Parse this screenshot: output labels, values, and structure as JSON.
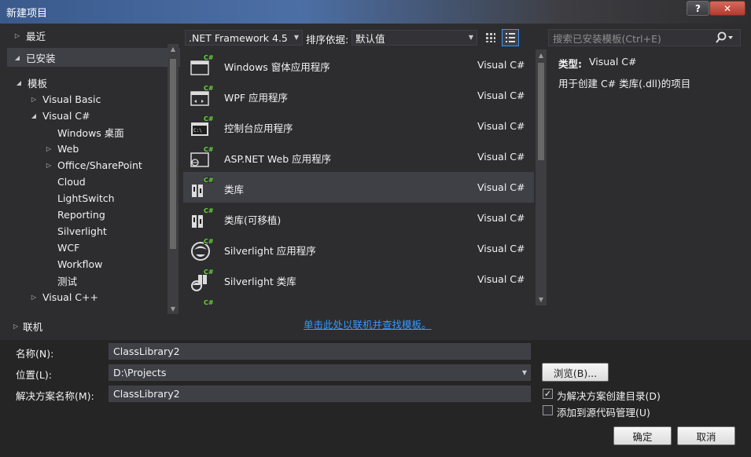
{
  "window": {
    "title": "新建项目",
    "help": "?",
    "close": "✕"
  },
  "left": {
    "recent": "最近",
    "installed": "已安装",
    "templates": "模板",
    "tree": [
      {
        "label": "Visual Basic",
        "tri": "▷"
      },
      {
        "label": "Visual C#",
        "tri": "◢"
      },
      {
        "label": "Windows 桌面",
        "tri": ""
      },
      {
        "label": "Web",
        "tri": "▷"
      },
      {
        "label": "Office/SharePoint",
        "tri": "▷"
      },
      {
        "label": "Cloud",
        "tri": ""
      },
      {
        "label": "LightSwitch",
        "tri": ""
      },
      {
        "label": "Reporting",
        "tri": ""
      },
      {
        "label": "Silverlight",
        "tri": ""
      },
      {
        "label": "WCF",
        "tri": ""
      },
      {
        "label": "Workflow",
        "tri": ""
      },
      {
        "label": "测试",
        "tri": ""
      },
      {
        "label": "Visual C++",
        "tri": "▷"
      }
    ],
    "online": "联机"
  },
  "toolbar": {
    "framework": ".NET Framework 4.5",
    "sort_label": "排序依据:",
    "sort_value": "默认值",
    "search_placeholder": "搜索已安装模板(Ctrl+E)"
  },
  "templates": [
    {
      "name": "Windows 窗体应用程序",
      "lang": "Visual C#",
      "icon": "windows-form-icon"
    },
    {
      "name": "WPF 应用程序",
      "lang": "Visual C#",
      "icon": "wpf-app-icon"
    },
    {
      "name": "控制台应用程序",
      "lang": "Visual C#",
      "icon": "console-app-icon"
    },
    {
      "name": "ASP.NET Web 应用程序",
      "lang": "Visual C#",
      "icon": "aspnet-web-icon"
    },
    {
      "name": "类库",
      "lang": "Visual C#",
      "icon": "class-library-icon"
    },
    {
      "name": "类库(可移植)",
      "lang": "Visual C#",
      "icon": "portable-library-icon"
    },
    {
      "name": "Silverlight 应用程序",
      "lang": "Visual C#",
      "icon": "silverlight-app-icon"
    },
    {
      "name": "Silverlight 类库",
      "lang": "Visual C#",
      "icon": "silverlight-library-icon"
    }
  ],
  "selected_template": 4,
  "icon_tag": "C#",
  "detail": {
    "type_label": "类型:",
    "type_value": "Visual C#",
    "description": "用于创建 C# 类库(.dll)的项目"
  },
  "online_link": "单击此处以联机并查找模板。",
  "form": {
    "name_label": "名称(N):",
    "name_value": "ClassLibrary2",
    "location_label": "位置(L):",
    "location_value": "D:\\Projects",
    "solution_label": "解决方案名称(M):",
    "solution_value": "ClassLibrary2",
    "browse": "浏览(B)...",
    "create_dir_label": "为解决方案创建目录(D)",
    "create_dir_checked": true,
    "source_control_label": "添加到源代码管理(U)",
    "source_control_checked": false,
    "ok": "确定",
    "cancel": "取消"
  },
  "colors": {
    "accent": "#3399ff",
    "csharp_tag": "#68d33a"
  }
}
